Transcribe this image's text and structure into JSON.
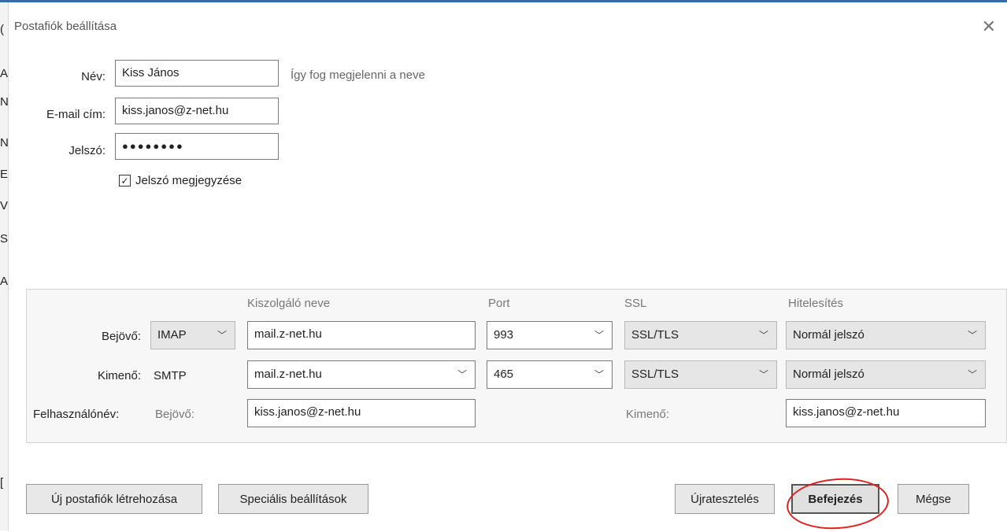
{
  "window": {
    "title": "Postafiók beállítása"
  },
  "left_strip": [
    "(",
    "A",
    "N",
    "N",
    "E",
    "V",
    "S",
    "A",
    "["
  ],
  "form": {
    "name_label": "Név:",
    "name_value": "Kiss János",
    "name_hint": "Így fog megjelenni a neve",
    "email_label": "E-mail cím:",
    "email_value": "kiss.janos@z-net.hu",
    "password_label": "Jelszó:",
    "password_value": "●●●●●●●●",
    "remember_label": "Jelszó megjegyzése",
    "remember_checked": true
  },
  "server_panel": {
    "headers": {
      "server_name": "Kiszolgáló neve",
      "port": "Port",
      "ssl": "SSL",
      "auth": "Hitelesítés"
    },
    "incoming": {
      "label": "Bejövő:",
      "protocol": "IMAP",
      "server": "mail.z-net.hu",
      "port": "993",
      "ssl": "SSL/TLS",
      "auth": "Normál jelszó"
    },
    "outgoing": {
      "label": "Kimenő:",
      "protocol": "SMTP",
      "server": "mail.z-net.hu",
      "port": "465",
      "ssl": "SSL/TLS",
      "auth": "Normál jelszó"
    },
    "username": {
      "label": "Felhasználónév:",
      "incoming_label": "Bejövő:",
      "incoming_value": "kiss.janos@z-net.hu",
      "outgoing_label": "Kimenő:",
      "outgoing_value": "kiss.janos@z-net.hu"
    }
  },
  "buttons": {
    "new_account": "Új postafiók létrehozása",
    "advanced": "Speciális beállítások",
    "retest": "Újratesztelés",
    "done": "Befejezés",
    "cancel": "Mégse"
  },
  "annotation_color": "#e02020"
}
